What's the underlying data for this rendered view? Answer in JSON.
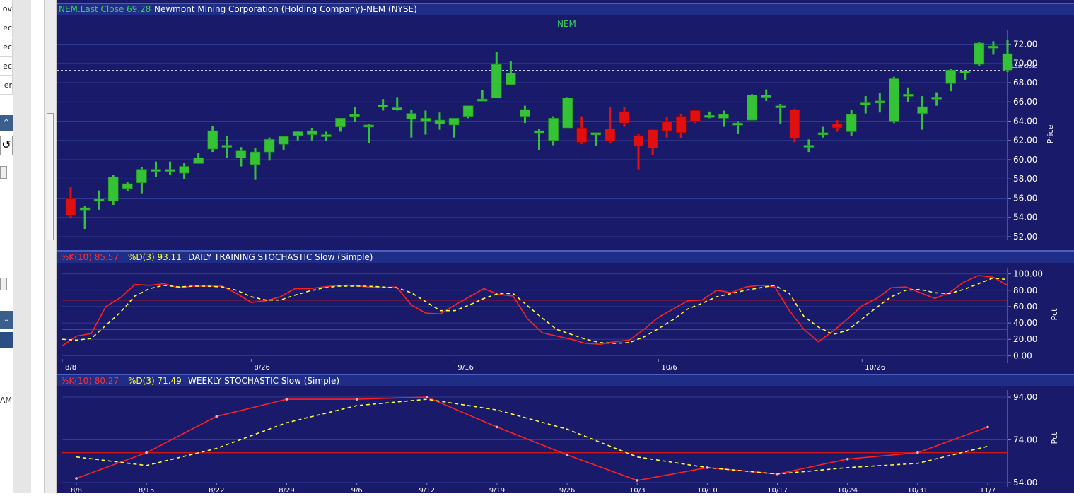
{
  "left_panel": {
    "rows": [
      "ov",
      "ec",
      "ec",
      "ec",
      "er"
    ],
    "time_fragment": "AM"
  },
  "price_panel": {
    "header": {
      "symbol_close": "NEM.Last Close 69.28",
      "company": "Newmont Mining Corporation (Holding Company)-NEM (NYSE)"
    },
    "chart_label": "NEM",
    "last_close_label": "Last Close",
    "axis_title": "Price",
    "last_close": 69.28
  },
  "daily_panel": {
    "header": {
      "k": "%K(10) 85.57",
      "d": "%D(3) 93.11",
      "title": "DAILY TRAINING STOCHASTIC Slow (Simple)"
    },
    "axis_title": "Pct"
  },
  "weekly_panel": {
    "header": {
      "k": "%K(10) 80.27",
      "d": "%D(3) 71.49",
      "title": "WEEKLY STOCHASTIC Slow (Simple)"
    },
    "axis_title": "Pct"
  },
  "colors": {
    "background": "#1a1a6a",
    "header_bar": "#1f2d86",
    "up": "#36c236",
    "down": "#e01010",
    "k_line": "#ff2020",
    "d_line": "#ffff33",
    "grid": "#2f3a90",
    "level": "#d01818",
    "axis_text": "#ffffff",
    "header_green": "#39d15a",
    "header_red": "#ff3030",
    "header_yellow": "#ffff33"
  },
  "chart_data": [
    {
      "type": "candlestick",
      "title": "NEM",
      "ylabel": "Price",
      "ylim": [
        52,
        73.5
      ],
      "yticks": [
        52,
        54,
        56,
        58,
        60,
        62,
        64,
        66,
        68,
        70,
        72
      ],
      "ytick_labels": [
        "52.00",
        "54.00",
        "56.00",
        "58.00",
        "60.00",
        "62.00",
        "64.00",
        "66.00",
        "68.00",
        "70.00",
        "72.00"
      ],
      "last_close": 69.28,
      "candles": [
        {
          "o": 56.0,
          "h": 57.2,
          "l": 53.9,
          "c": 54.2
        },
        {
          "o": 55.0,
          "h": 55.2,
          "l": 52.8,
          "c": 55.0
        },
        {
          "o": 55.9,
          "h": 56.8,
          "l": 54.8,
          "c": 55.9
        },
        {
          "o": 55.7,
          "h": 58.4,
          "l": 55.3,
          "c": 58.2
        },
        {
          "o": 57.0,
          "h": 57.7,
          "l": 56.7,
          "c": 57.5
        },
        {
          "o": 57.6,
          "h": 59.2,
          "l": 56.5,
          "c": 59.0
        },
        {
          "o": 58.9,
          "h": 59.8,
          "l": 58.2,
          "c": 59.0
        },
        {
          "o": 58.9,
          "h": 59.8,
          "l": 58.4,
          "c": 59.0
        },
        {
          "o": 58.6,
          "h": 59.7,
          "l": 58.0,
          "c": 59.3
        },
        {
          "o": 59.6,
          "h": 60.7,
          "l": 59.6,
          "c": 60.2
        },
        {
          "o": 61.1,
          "h": 63.5,
          "l": 60.8,
          "c": 63.0
        },
        {
          "o": 61.5,
          "h": 62.5,
          "l": 60.2,
          "c": 61.5
        },
        {
          "o": 60.2,
          "h": 61.3,
          "l": 59.3,
          "c": 60.9
        },
        {
          "o": 59.5,
          "h": 61.2,
          "l": 57.9,
          "c": 60.8
        },
        {
          "o": 60.8,
          "h": 62.3,
          "l": 59.9,
          "c": 62.1
        },
        {
          "o": 61.6,
          "h": 62.4,
          "l": 61.0,
          "c": 62.4
        },
        {
          "o": 62.5,
          "h": 63.0,
          "l": 62.0,
          "c": 62.9
        },
        {
          "o": 62.6,
          "h": 63.3,
          "l": 62.0,
          "c": 63.0
        },
        {
          "o": 62.6,
          "h": 62.9,
          "l": 61.9,
          "c": 62.6
        },
        {
          "o": 63.4,
          "h": 64.3,
          "l": 62.9,
          "c": 64.3
        },
        {
          "o": 64.7,
          "h": 65.5,
          "l": 63.9,
          "c": 64.7
        },
        {
          "o": 63.6,
          "h": 63.7,
          "l": 61.7,
          "c": 63.6
        },
        {
          "o": 65.7,
          "h": 66.3,
          "l": 65.1,
          "c": 65.7
        },
        {
          "o": 65.4,
          "h": 66.5,
          "l": 65.1,
          "c": 65.4
        },
        {
          "o": 64.2,
          "h": 65.2,
          "l": 62.3,
          "c": 64.8
        },
        {
          "o": 64.0,
          "h": 65.1,
          "l": 62.6,
          "c": 64.3
        },
        {
          "o": 63.7,
          "h": 64.9,
          "l": 63.1,
          "c": 64.1
        },
        {
          "o": 63.6,
          "h": 64.3,
          "l": 62.3,
          "c": 64.3
        },
        {
          "o": 64.5,
          "h": 65.6,
          "l": 64.3,
          "c": 65.6
        },
        {
          "o": 66.3,
          "h": 67.2,
          "l": 66.1,
          "c": 66.3
        },
        {
          "o": 66.4,
          "h": 71.2,
          "l": 66.4,
          "c": 69.9
        },
        {
          "o": 67.8,
          "h": 70.2,
          "l": 67.7,
          "c": 69.0
        },
        {
          "o": 64.5,
          "h": 65.6,
          "l": 63.8,
          "c": 65.2
        },
        {
          "o": 63.0,
          "h": 63.2,
          "l": 61.0,
          "c": 63.0
        },
        {
          "o": 62.0,
          "h": 64.5,
          "l": 61.5,
          "c": 64.3
        },
        {
          "o": 63.3,
          "h": 66.5,
          "l": 63.3,
          "c": 66.4
        },
        {
          "o": 63.3,
          "h": 64.5,
          "l": 61.6,
          "c": 61.8
        },
        {
          "o": 62.8,
          "h": 62.8,
          "l": 61.4,
          "c": 62.8
        },
        {
          "o": 63.2,
          "h": 65.5,
          "l": 61.7,
          "c": 61.9
        },
        {
          "o": 65.0,
          "h": 65.5,
          "l": 63.4,
          "c": 63.8
        },
        {
          "o": 62.5,
          "h": 62.7,
          "l": 59.0,
          "c": 61.4
        },
        {
          "o": 63.1,
          "h": 63.2,
          "l": 60.5,
          "c": 61.2
        },
        {
          "o": 64.0,
          "h": 64.4,
          "l": 62.3,
          "c": 63.0
        },
        {
          "o": 64.5,
          "h": 64.7,
          "l": 62.2,
          "c": 62.8
        },
        {
          "o": 65.1,
          "h": 65.2,
          "l": 63.8,
          "c": 64.0
        },
        {
          "o": 64.6,
          "h": 65.0,
          "l": 64.3,
          "c": 64.6
        },
        {
          "o": 64.3,
          "h": 65.1,
          "l": 63.4,
          "c": 64.7
        },
        {
          "o": 63.8,
          "h": 64.0,
          "l": 62.7,
          "c": 63.8
        },
        {
          "o": 64.1,
          "h": 66.8,
          "l": 64.1,
          "c": 66.7
        },
        {
          "o": 66.5,
          "h": 67.3,
          "l": 66.1,
          "c": 66.7
        },
        {
          "o": 65.6,
          "h": 65.8,
          "l": 63.7,
          "c": 65.6
        },
        {
          "o": 65.2,
          "h": 65.3,
          "l": 61.8,
          "c": 62.2
        },
        {
          "o": 61.5,
          "h": 62.1,
          "l": 60.8,
          "c": 61.5
        },
        {
          "o": 62.8,
          "h": 63.4,
          "l": 62.3,
          "c": 62.8
        },
        {
          "o": 63.7,
          "h": 64.1,
          "l": 62.9,
          "c": 63.3
        },
        {
          "o": 62.9,
          "h": 65.2,
          "l": 62.5,
          "c": 64.7
        },
        {
          "o": 65.9,
          "h": 66.6,
          "l": 64.8,
          "c": 65.9
        },
        {
          "o": 66.1,
          "h": 66.9,
          "l": 64.9,
          "c": 66.1
        },
        {
          "o": 64.0,
          "h": 68.6,
          "l": 63.8,
          "c": 68.4
        },
        {
          "o": 66.8,
          "h": 67.5,
          "l": 66.0,
          "c": 66.8
        },
        {
          "o": 64.8,
          "h": 66.6,
          "l": 63.1,
          "c": 65.5
        },
        {
          "o": 66.5,
          "h": 67.0,
          "l": 65.6,
          "c": 66.5
        },
        {
          "o": 67.9,
          "h": 69.4,
          "l": 67.1,
          "c": 69.3
        },
        {
          "o": 69.0,
          "h": 69.3,
          "l": 68.3,
          "c": 69.2
        },
        {
          "o": 69.9,
          "h": 72.2,
          "l": 69.7,
          "c": 72.1
        },
        {
          "o": 71.8,
          "h": 72.3,
          "l": 70.9,
          "c": 71.8
        },
        {
          "o": 69.3,
          "h": 72.4,
          "l": 69.1,
          "c": 71.0
        }
      ]
    },
    {
      "type": "line",
      "title": "DAILY TRAINING STOCHASTIC Slow (Simple)",
      "ylabel": "Pct",
      "ylim": [
        -4,
        104
      ],
      "yticks": [
        0,
        20,
        40,
        60,
        80,
        100
      ],
      "ytick_labels": [
        "0.00",
        "20.00",
        "40.00",
        "60.00",
        "80.00",
        "100.00"
      ],
      "levels": [
        68,
        32
      ],
      "x_tick_labels": [
        {
          "index": 0,
          "label": "8/8"
        },
        {
          "index": 13,
          "label": "8/26"
        },
        {
          "index": 27,
          "label": "9/16"
        },
        {
          "index": 41,
          "label": "10/6"
        },
        {
          "index": 55,
          "label": "10/26"
        }
      ],
      "series": [
        {
          "name": "%K(10)",
          "values": [
            12,
            24,
            27,
            60,
            71,
            87,
            86,
            88,
            83,
            85,
            85,
            85,
            76,
            65,
            67,
            72,
            82,
            82,
            84,
            86,
            86,
            84,
            83,
            84,
            62,
            52,
            51,
            62,
            72,
            82,
            75,
            73,
            45,
            28,
            24,
            20,
            15,
            14,
            17,
            19,
            32,
            47,
            57,
            67,
            68,
            80,
            77,
            84,
            86,
            84,
            55,
            32,
            17,
            30,
            45,
            61,
            70,
            83,
            84,
            77,
            70,
            77,
            90,
            98,
            96,
            86
          ]
        },
        {
          "name": "%D(3)",
          "values": [
            20,
            19,
            21,
            37,
            53,
            73,
            82,
            86,
            84,
            85,
            85,
            84,
            80,
            72,
            68,
            68,
            74,
            79,
            83,
            85,
            85,
            85,
            84,
            83,
            77,
            66,
            55,
            55,
            62,
            70,
            76,
            76,
            61,
            46,
            32,
            26,
            20,
            16,
            15,
            16,
            23,
            33,
            44,
            57,
            64,
            72,
            76,
            80,
            83,
            86,
            76,
            48,
            35,
            26,
            31,
            45,
            59,
            72,
            80,
            81,
            77,
            76,
            81,
            88,
            95,
            93
          ]
        }
      ]
    },
    {
      "type": "line",
      "title": "WEEKLY STOCHASTIC Slow (Simple)",
      "ylabel": "Pct",
      "ylim": [
        54,
        96
      ],
      "yticks": [
        54,
        74,
        94
      ],
      "ytick_labels": [
        "54.00",
        "74.00",
        "94.00"
      ],
      "levels": [
        68
      ],
      "categories": [
        "8/8",
        "8/15",
        "8/22",
        "8/29",
        "9/6",
        "9/12",
        "9/19",
        "9/26",
        "10/3",
        "10/10",
        "10/17",
        "10/24",
        "10/31",
        "11/7"
      ],
      "series": [
        {
          "name": "%K(10)",
          "values": [
            56,
            68,
            85,
            93,
            93,
            94,
            80,
            67,
            55,
            61,
            58,
            65,
            68,
            80
          ]
        },
        {
          "name": "%D(3)",
          "values": [
            66,
            62,
            70,
            82,
            90,
            93,
            88,
            79,
            66,
            61,
            58,
            61,
            63,
            71
          ]
        }
      ]
    }
  ]
}
